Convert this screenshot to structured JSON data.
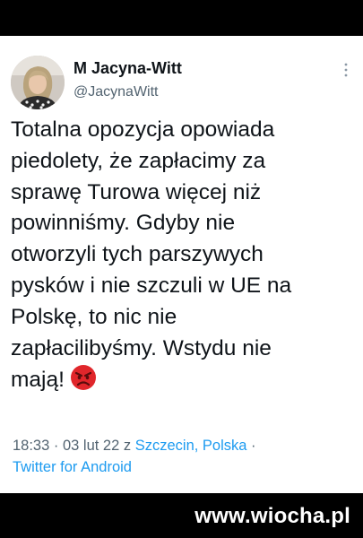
{
  "tweet": {
    "author_name": "M Jacyna-Witt",
    "author_handle": "@JacynaWitt",
    "text_lines": [
      "Totalna opozycja opowiada",
      "piedolety, że zapłacimy za",
      "sprawę Turowa więcej niż",
      "powinniśmy. Gdyby nie",
      "otworzyli tych parszywych",
      "pysków i nie szczuli w UE na",
      "Polskę, to nic nie",
      "zapłacilibyśmy. Wstydu nie",
      "mają!"
    ],
    "emoji": "angry-face-emoji",
    "time": "18:33",
    "separator": "·",
    "date": "03 lut 22",
    "location_prefix": "z",
    "location": "Szczecin, Polska",
    "source": "Twitter for Android"
  },
  "watermark": "www.wiocha.pl",
  "icons": {
    "more": "more-vertical-icon",
    "avatar": "avatar"
  },
  "colors": {
    "background": "#000000",
    "card": "#ffffff",
    "text": "#0f1419",
    "secondary": "#536471",
    "link": "#1d9bf0",
    "emoji": "#e0262b"
  }
}
